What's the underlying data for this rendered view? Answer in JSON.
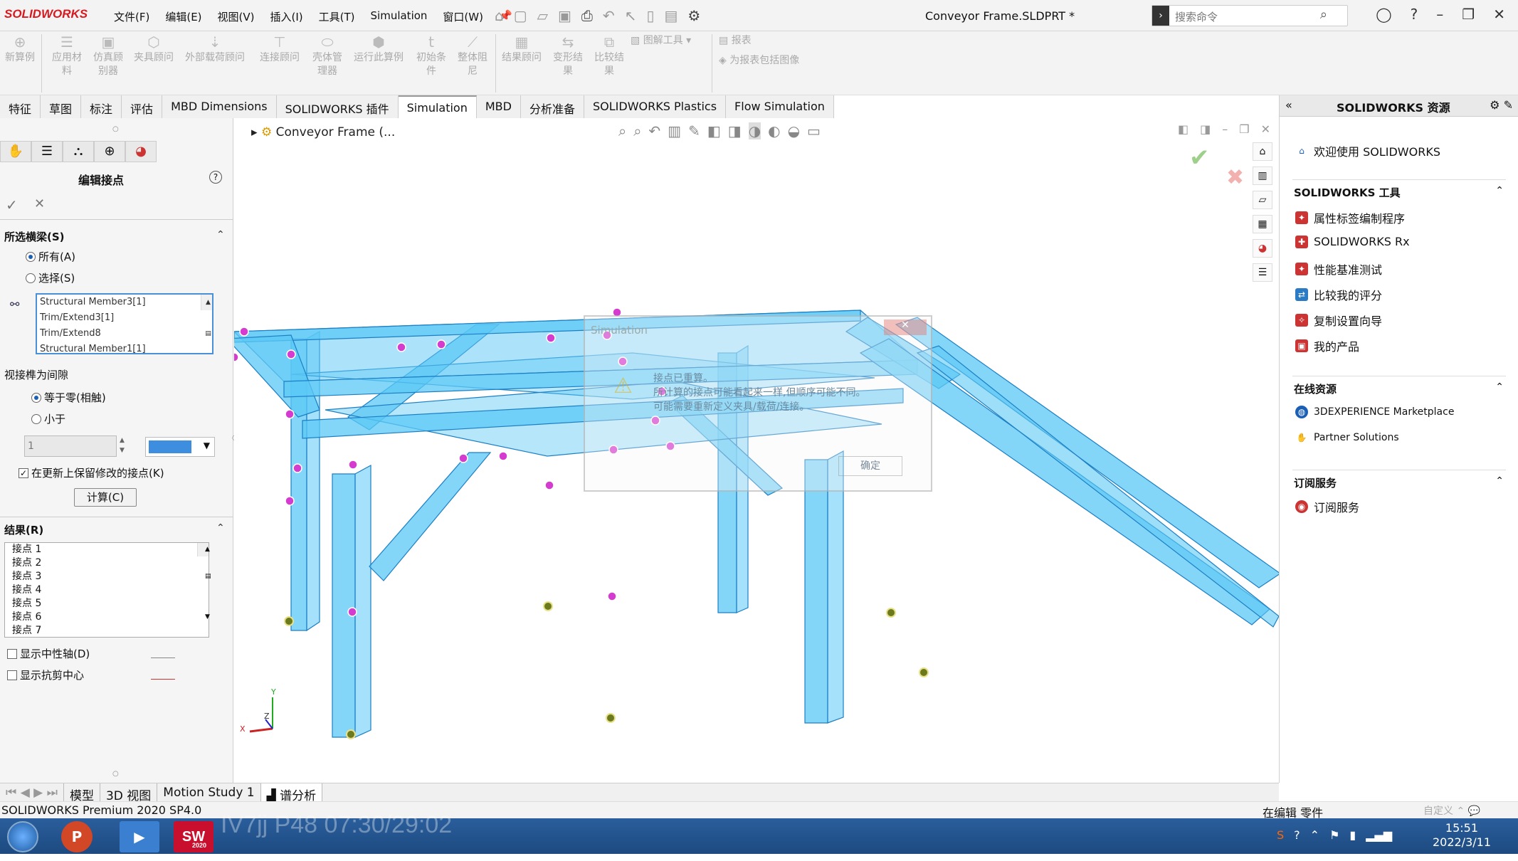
{
  "app": {
    "logo": "SOLIDWORKS",
    "document_title": "Conveyor Frame.SLDPRT *"
  },
  "menu": [
    "文件(F)",
    "编辑(E)",
    "视图(V)",
    "插入(I)",
    "工具(T)",
    "Simulation",
    "窗口(W)"
  ],
  "search": {
    "placeholder": "搜索命令"
  },
  "ribbon": [
    {
      "label": "新算例",
      "icon": "new-study-icon"
    },
    {
      "label": "应用材料",
      "icon": "material-icon"
    },
    {
      "label": "仿真顾别器",
      "icon": "sim-advisor-icon"
    },
    {
      "label": "夹具顾问",
      "icon": "fixture-icon"
    },
    {
      "label": "外部载荷顾问",
      "icon": "load-icon"
    },
    {
      "label": "连接顾问",
      "icon": "connection-icon"
    },
    {
      "label": "壳体管理器",
      "icon": "shell-icon"
    },
    {
      "label": "运行此算例",
      "icon": "run-icon"
    },
    {
      "label": "初始条件",
      "icon": "initial-icon"
    },
    {
      "label": "整体阻尼",
      "icon": "damping-icon"
    },
    {
      "label": "结果顾问",
      "icon": "result-icon"
    },
    {
      "label": "变形结果",
      "icon": "deform-icon"
    },
    {
      "label": "比较结果",
      "icon": "compare-icon"
    },
    {
      "label": "图解工具",
      "icon": "plot-tools-icon"
    },
    {
      "label": "报表",
      "icon": "report-icon"
    },
    {
      "label": "为报表包括图像",
      "icon": "image-report-icon"
    }
  ],
  "cmd_tabs": [
    "特征",
    "草图",
    "标注",
    "评估",
    "MBD Dimensions",
    "SOLIDWORKS 插件",
    "Simulation",
    "MBD",
    "分析准备",
    "SOLIDWORKS Plastics",
    "Flow Simulation"
  ],
  "active_cmd_tab": "Simulation",
  "property_manager": {
    "title": "编辑接点",
    "section_selected": "所选横梁(S)",
    "radio_all": "所有(A)",
    "radio_select": "选择(S)",
    "list_items": [
      "Structural Member3[1]",
      "Trim/Extend3[1]",
      "Trim/Extend8",
      "Structural Member1[1]"
    ],
    "gap_label": "视接榫为间隙",
    "radio_equal_zero": "等于零(相触)",
    "radio_less_than": "小于",
    "gap_value": "1",
    "keep_modified": "在更新上保留修改的接点(K)",
    "calc_button": "计算(C)",
    "results_label": "结果(R)",
    "results": [
      "接点 1",
      "接点 2",
      "接点 3",
      "接点 4",
      "接点 5",
      "接点 6",
      "接点 7"
    ],
    "show_neutral": "显示中性轴(D)",
    "show_shear": "显示抗剪中心"
  },
  "viewport": {
    "tree_title": "Conveyor Frame (...",
    "axis_y": "Y",
    "axis_z": "Z",
    "axis_x": "X",
    "dialog": {
      "title": "Simulation",
      "message_1": "接点已重算。",
      "message_2": "所计算的接点可能看起来一样,但顺序可能不同。",
      "message_3": "可能需要重新定义夹具/载荷/连接。",
      "ok": "确定"
    }
  },
  "resources": {
    "title": "SOLIDWORKS 资源",
    "welcome": "欢迎使用 SOLIDWORKS",
    "tools_header": "SOLIDWORKS 工具",
    "tools": [
      "属性标签编制程序",
      "SOLIDWORKS Rx",
      "性能基准测试",
      "比较我的评分",
      "复制设置向导",
      "我的产品"
    ],
    "online_header": "在线资源",
    "online": [
      "3DEXPERIENCE Marketplace",
      "Partner Solutions"
    ],
    "sub_header": "订阅服务",
    "sub": [
      "订阅服务"
    ]
  },
  "bottom_tabs": [
    "模型",
    "3D 视图",
    "Motion Study 1",
    "谱分析"
  ],
  "status": {
    "left": "SOLIDWORKS Premium 2020 SP4.0",
    "mid": "在编辑 零件",
    "right": "自定义"
  },
  "taskbar": {
    "overlay": "IV7jj P48 07:30/29:02",
    "time": "15:51",
    "date": "2022/3/11",
    "sw_year": "2020"
  }
}
